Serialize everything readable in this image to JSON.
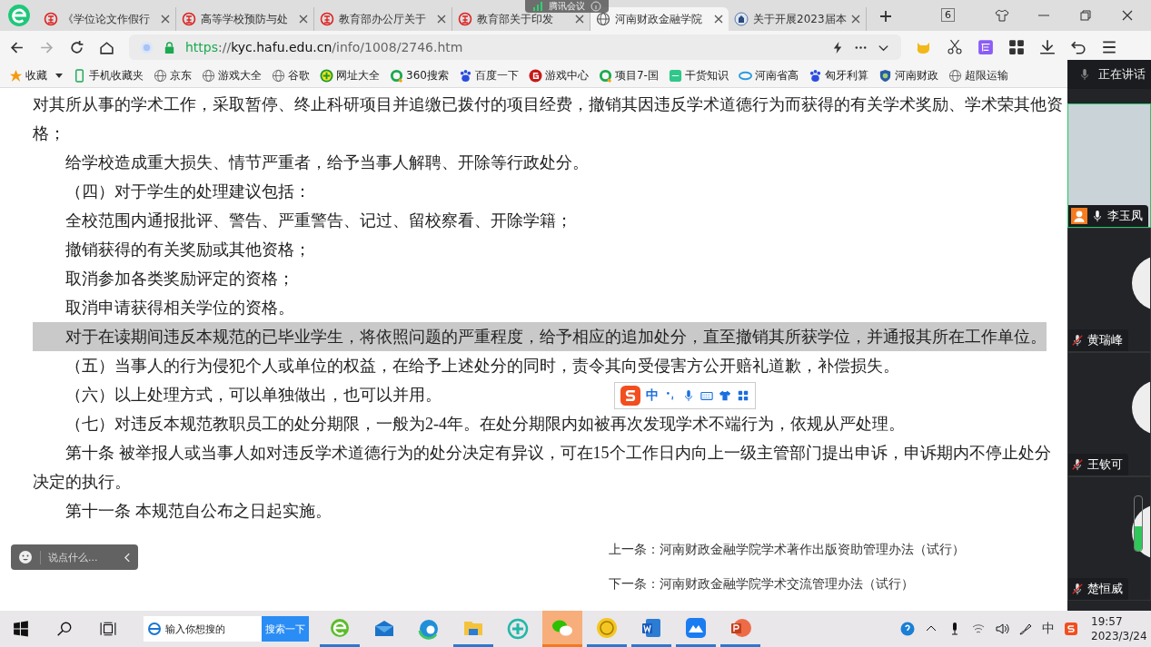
{
  "browser": {
    "tabs": [
      {
        "title": "《学位论文作假行",
        "kind": "seal",
        "selected": false
      },
      {
        "title": "高等学校预防与处",
        "kind": "seal",
        "selected": false
      },
      {
        "title": "教育部办公厅关于",
        "kind": "seal",
        "selected": false
      },
      {
        "title": "教育部关于印发",
        "kind": "seal",
        "selected": false
      },
      {
        "title": "河南财政金融学院",
        "kind": "globe",
        "selected": true
      },
      {
        "title": "关于开展2023届本",
        "kind": "badge",
        "selected": false
      }
    ],
    "tab_count": "6",
    "address": {
      "scheme": "https",
      "separator": "://",
      "host": "kyc.hafu.edu.cn",
      "path": "/info/1008/2746.htm"
    },
    "bookmarks": [
      {
        "label": "收藏",
        "kind": "star"
      },
      {
        "label": "手机收藏夹",
        "kind": "phone"
      },
      {
        "label": "京东",
        "kind": "globe"
      },
      {
        "label": "游戏大全",
        "kind": "globe"
      },
      {
        "label": "谷歌",
        "kind": "globe"
      },
      {
        "label": "网址大全",
        "kind": "plus"
      },
      {
        "label": "360搜索",
        "kind": "ring"
      },
      {
        "label": "百度一下",
        "kind": "paw"
      },
      {
        "label": "游戏中心",
        "kind": "game"
      },
      {
        "label": "项目7-国",
        "kind": "ring"
      },
      {
        "label": "干货知识",
        "kind": "tile"
      },
      {
        "label": "河南省高",
        "kind": "cloud"
      },
      {
        "label": "匈牙利算",
        "kind": "paw"
      },
      {
        "label": "河南财政",
        "kind": "shield"
      },
      {
        "label": "超限运输",
        "kind": "globe"
      }
    ]
  },
  "meeting_overlay": {
    "title": "腾讯会议"
  },
  "article": {
    "paragraphs": [
      {
        "text": "对其所从事的学术工作，采取暂停、终止科研项目并追缴已拨付的项目经费，撤销其因违反学术道德行为而获得的有关学术奖励、学术荣其他资格；",
        "indent": false,
        "highlighted": false
      },
      {
        "text": "给学校造成重大损失、情节严重者，给予当事人解聘、开除等行政处分。",
        "indent": true,
        "highlighted": false
      },
      {
        "text": "（四）对于学生的处理建议包括：",
        "indent": true,
        "highlighted": false
      },
      {
        "text": "全校范围内通报批评、警告、严重警告、记过、留校察看、开除学籍；",
        "indent": true,
        "highlighted": false
      },
      {
        "text": "撤销获得的有关奖励或其他资格；",
        "indent": true,
        "highlighted": false
      },
      {
        "text": "取消参加各类奖励评定的资格；",
        "indent": true,
        "highlighted": false
      },
      {
        "text": "取消申请获得相关学位的资格。",
        "indent": true,
        "highlighted": false
      },
      {
        "text": "对于在读期间违反本规范的已毕业学生，将依照问题的严重程度，给予相应的追加处分，直至撤销其所获学位，并通报其所在工作单位。",
        "indent": true,
        "highlighted": true
      },
      {
        "text": "（五）当事人的行为侵犯个人或单位的权益，在给予上述处分的同时，责令其向受侵害方公开赔礼道歉，补偿损失。",
        "indent": true,
        "highlighted": false
      },
      {
        "text": "（六）以上处理方式，可以单独做出，也可以并用。",
        "indent": true,
        "highlighted": false
      },
      {
        "text": "（七）对违反本规范教职员工的处分期限，一般为2-4年。在处分期限内如被再次发现学术不端行为，依规从严处理。",
        "indent": true,
        "highlighted": false
      },
      {
        "text": "第十条 被举报人或当事人如对违反学术道德行为的处分决定有异议，可在15个工作日内向上一级主管部门提出申诉，申诉期内不停止处分决定的执行。",
        "indent": true,
        "highlighted": false
      },
      {
        "text": "第十一条 本规范自公布之日起实施。",
        "indent": true,
        "highlighted": false
      }
    ],
    "prev_link": "上一条：河南财政金融学院学术著作出版资助管理办法（试行）",
    "next_link": "下一条：河南财政金融学院学术交流管理办法（试行）"
  },
  "chat_bar": {
    "placeholder": "说点什么..."
  },
  "ime_toolbar": {
    "mode": "中"
  },
  "meeting_panel": {
    "status": "正在讲话",
    "participants": [
      {
        "name": "李玉凤",
        "muted": false,
        "speaking": true,
        "camera_on": true
      },
      {
        "name": "黄瑞峰",
        "muted": true,
        "speaking": false,
        "camera_on": false
      },
      {
        "name": "王钦可",
        "muted": true,
        "speaking": false,
        "camera_on": false
      },
      {
        "name": "楚恒威",
        "muted": true,
        "speaking": false,
        "camera_on": false,
        "level": 0.45
      }
    ]
  },
  "taskbar": {
    "search_placeholder": "输入你想搜的",
    "search_button": "搜索一下",
    "apps": [
      {
        "kind": "ie",
        "running": true,
        "highlighted": false
      },
      {
        "kind": "mail",
        "running": false,
        "highlighted": false
      },
      {
        "kind": "edge",
        "running": false,
        "highlighted": false
      },
      {
        "kind": "folder",
        "running": true,
        "highlighted": false
      },
      {
        "kind": "plus",
        "running": false,
        "highlighted": false
      },
      {
        "kind": "chat",
        "running": true,
        "highlighted": true
      },
      {
        "kind": "coin",
        "running": true,
        "highlighted": false
      },
      {
        "kind": "word",
        "running": true,
        "highlighted": false
      },
      {
        "kind": "meet",
        "running": true,
        "highlighted": false
      },
      {
        "kind": "ppt",
        "running": true,
        "highlighted": false
      }
    ],
    "ime": "中",
    "time": "19:57",
    "date": "2023/3/24"
  }
}
